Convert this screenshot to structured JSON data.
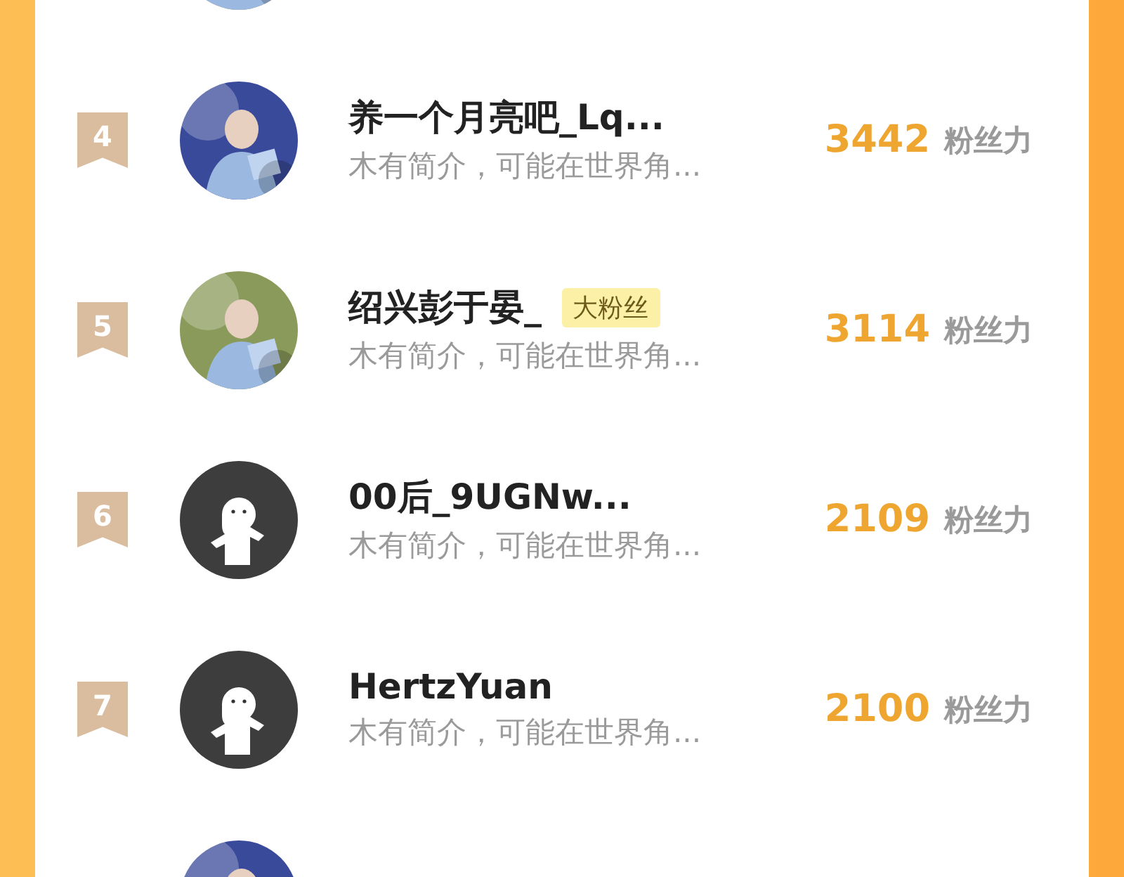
{
  "rows": [
    {
      "avatar": {
        "kind": "picture"
      }
    },
    {
      "rank": "4",
      "avatar": {
        "kind": "picture"
      },
      "name": "养一个月亮吧_Lq...",
      "intro": "木有简介，可能在世界角...",
      "score": "3442",
      "score_unit": "粉丝力"
    },
    {
      "rank": "5",
      "avatar": {
        "kind": "picture"
      },
      "name": "绍兴彭于晏_",
      "tag": "大粉丝",
      "intro": "木有简介，可能在世界角...",
      "score": "3114",
      "score_unit": "粉丝力"
    },
    {
      "rank": "6",
      "avatar": {
        "kind": "default"
      },
      "name": "00后_9UGNw...",
      "intro": "木有简介，可能在世界角...",
      "score": "2109",
      "score_unit": "粉丝力"
    },
    {
      "rank": "7",
      "avatar": {
        "kind": "default"
      },
      "name": "HertzYuan",
      "intro": "木有简介，可能在世界角...",
      "score": "2100",
      "score_unit": "粉丝力"
    },
    {
      "avatar": {
        "kind": "picture"
      }
    }
  ]
}
